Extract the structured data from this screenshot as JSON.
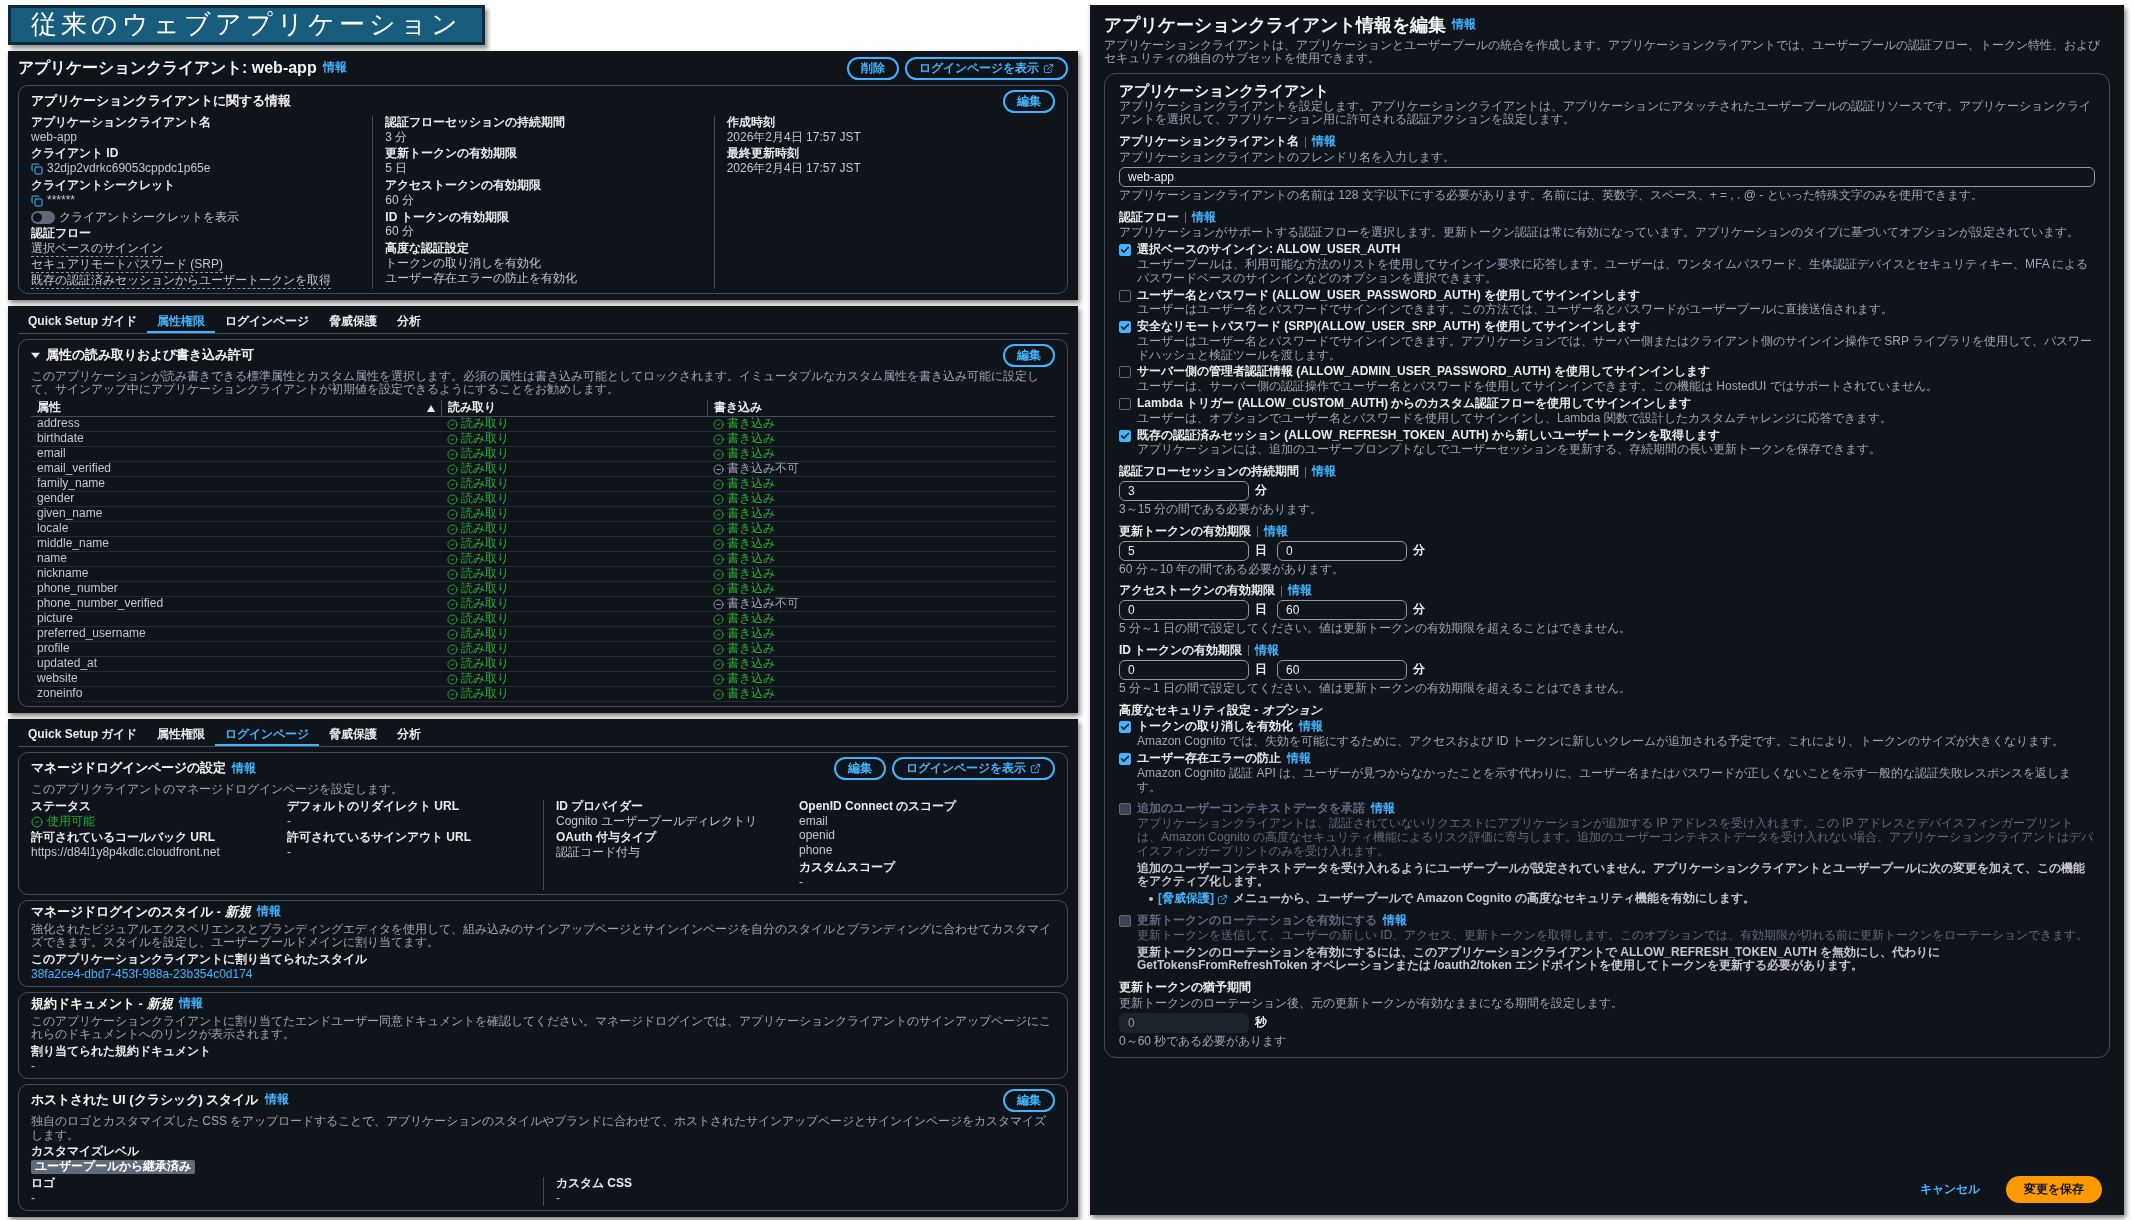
{
  "slide_title": "従来のウェブアプリケーション",
  "client_summary": {
    "title": "アプリケーションクライアント: web-app",
    "info": "情報",
    "buttons": [
      {
        "label": "削除",
        "external": false
      },
      {
        "label": "ログインページを表示",
        "external": true
      }
    ],
    "card": {
      "title": "アプリケーションクライアントに関する情報",
      "buttons": [
        {
          "label": "編集",
          "external": false
        }
      ],
      "rows": [
        [
          [
            {
              "label": "アプリケーションクライアント名",
              "kind": "text",
              "values": [
                "web-app"
              ]
            },
            {
              "label": "クライアント ID",
              "kind": "copy",
              "values": [
                "32djp2vdrkc69053cppdc1p65e"
              ]
            },
            {
              "label": "クライアントシークレット",
              "kind": "copy",
              "values": [
                "******"
              ]
            },
            {
              "label": "クライアントシークレットを表示",
              "kind": "toggle",
              "on": false
            },
            {
              "label": "認証フロー",
              "kind": "links",
              "values": [
                "選択ベースのサインイン",
                "セキュアリモートパスワード (SRP)",
                "既存の認証済みセッションからユーザートークンを取得"
              ]
            }
          ],
          [
            {
              "label": "認証フローセッションの持続期間",
              "kind": "text",
              "values": [
                "3 分"
              ]
            },
            {
              "label": "更新トークンの有効期限",
              "kind": "text",
              "values": [
                "5 日"
              ]
            },
            {
              "label": "アクセストークンの有効期限",
              "kind": "text",
              "values": [
                "60 分"
              ]
            },
            {
              "label": "ID トークンの有効期限",
              "kind": "text",
              "values": [
                "60 分"
              ]
            },
            {
              "label": "高度な認証設定",
              "kind": "text",
              "values": [
                "トークンの取り消しを有効化",
                "ユーザー存在エラーの防止を有効化"
              ]
            }
          ],
          [
            {
              "label": "作成時刻",
              "kind": "text",
              "values": [
                "2026年2月4日 17:57 JST"
              ]
            },
            {
              "label": "最終更新時刻",
              "kind": "text",
              "values": [
                "2026年2月4日 17:57 JST"
              ]
            }
          ]
        ]
      ]
    }
  },
  "attributes_tab": {
    "tabs": [
      {
        "label": "Quick Setup ガイド",
        "selected": false
      },
      {
        "label": "属性権限",
        "selected": true
      },
      {
        "label": "ログインページ",
        "selected": false
      },
      {
        "label": "脅威保護",
        "selected": false
      },
      {
        "label": "分析",
        "selected": false
      }
    ],
    "section": {
      "title": "属性の読み取りおよび書き込み許可",
      "expanded": true,
      "buttons": [
        {
          "label": "編集",
          "external": false
        }
      ],
      "desc": "このアプリケーションが読み書きできる標準属性とカスタム属性を選択します。必須の属性は書き込み可能としてロックされます。イミュータブルなカスタム属性を書き込み可能に設定して、サインアップ中にアプリケーションクライアントが初期値を設定できるようにすることをお勧めします。",
      "columns": [
        {
          "label": "属性",
          "sorted": true
        },
        {
          "label": "読み取り",
          "sorted": false
        },
        {
          "label": "書き込み",
          "sorted": false
        }
      ],
      "rows": [
        {
          "attribute": "address",
          "read": "読み取り",
          "read_allowed": true,
          "write": "書き込み",
          "write_allowed": true
        },
        {
          "attribute": "birthdate",
          "read": "読み取り",
          "read_allowed": true,
          "write": "書き込み",
          "write_allowed": true
        },
        {
          "attribute": "email",
          "read": "読み取り",
          "read_allowed": true,
          "write": "書き込み",
          "write_allowed": true
        },
        {
          "attribute": "email_verified",
          "read": "読み取り",
          "read_allowed": true,
          "write": "書き込み不可",
          "write_allowed": false
        },
        {
          "attribute": "family_name",
          "read": "読み取り",
          "read_allowed": true,
          "write": "書き込み",
          "write_allowed": true
        },
        {
          "attribute": "gender",
          "read": "読み取り",
          "read_allowed": true,
          "write": "書き込み",
          "write_allowed": true
        },
        {
          "attribute": "given_name",
          "read": "読み取り",
          "read_allowed": true,
          "write": "書き込み",
          "write_allowed": true
        },
        {
          "attribute": "locale",
          "read": "読み取り",
          "read_allowed": true,
          "write": "書き込み",
          "write_allowed": true
        },
        {
          "attribute": "middle_name",
          "read": "読み取り",
          "read_allowed": true,
          "write": "書き込み",
          "write_allowed": true
        },
        {
          "attribute": "name",
          "read": "読み取り",
          "read_allowed": true,
          "write": "書き込み",
          "write_allowed": true
        },
        {
          "attribute": "nickname",
          "read": "読み取り",
          "read_allowed": true,
          "write": "書き込み",
          "write_allowed": true
        },
        {
          "attribute": "phone_number",
          "read": "読み取り",
          "read_allowed": true,
          "write": "書き込み",
          "write_allowed": true
        },
        {
          "attribute": "phone_number_verified",
          "read": "読み取り",
          "read_allowed": true,
          "write": "書き込み不可",
          "write_allowed": false
        },
        {
          "attribute": "picture",
          "read": "読み取り",
          "read_allowed": true,
          "write": "書き込み",
          "write_allowed": true
        },
        {
          "attribute": "preferred_username",
          "read": "読み取り",
          "read_allowed": true,
          "write": "書き込み",
          "write_allowed": true
        },
        {
          "attribute": "profile",
          "read": "読み取り",
          "read_allowed": true,
          "write": "書き込み",
          "write_allowed": true
        },
        {
          "attribute": "updated_at",
          "read": "読み取り",
          "read_allowed": true,
          "write": "書き込み",
          "write_allowed": true
        },
        {
          "attribute": "website",
          "read": "読み取り",
          "read_allowed": true,
          "write": "書き込み",
          "write_allowed": true
        },
        {
          "attribute": "zoneinfo",
          "read": "読み取り",
          "read_allowed": true,
          "write": "書き込み",
          "write_allowed": true
        }
      ]
    }
  },
  "login_tab": {
    "tabs": [
      {
        "label": "Quick Setup ガイド",
        "selected": false
      },
      {
        "label": "属性権限",
        "selected": false
      },
      {
        "label": "ログインページ",
        "selected": true
      },
      {
        "label": "脅威保護",
        "selected": false
      },
      {
        "label": "分析",
        "selected": false
      }
    ],
    "sections": [
      {
        "title": "マネージドログインページの設定",
        "info": "情報",
        "buttons": [
          {
            "label": "編集",
            "external": false
          },
          {
            "label": "ログインページを表示",
            "external": true
          }
        ],
        "desc": "このアプリクライアントのマネージドログインページを設定します。",
        "rows": [
          [
            [
              {
                "label": "ステータス",
                "kind": "status",
                "values": [
                  "使用可能"
                ]
              },
              {
                "label": "許可されているコールバック URL",
                "kind": "text",
                "values": [
                  "https://d84l1y8p4kdlc.cloudfront.net"
                ]
              }
            ],
            [
              {
                "label": "デフォルトのリダイレクト URL",
                "kind": "text",
                "values": [
                  "-"
                ]
              },
              {
                "label": "許可されているサインアウト URL",
                "kind": "text",
                "values": [
                  "-"
                ]
              }
            ],
            [
              {
                "label": "ID プロバイダー",
                "kind": "text",
                "values": [
                  "Cognito ユーザープールディレクトリ"
                ]
              },
              {
                "label": "OAuth 付与タイプ",
                "kind": "text",
                "values": [
                  "認証コード付与"
                ]
              }
            ],
            [
              {
                "label": "OpenID Connect のスコープ",
                "kind": "text",
                "values": [
                  "email",
                  "openid",
                  "phone"
                ]
              },
              {
                "label": "カスタムスコープ",
                "kind": "text",
                "values": [
                  "-"
                ]
              }
            ]
          ]
        ]
      },
      {
        "title": "マネージドログインのスタイル - *新規*",
        "info": "情報",
        "desc": "強化されたビジュアルエクスペリエンスとブランディングエディタを使用して、組み込みのサインアップページとサインインページを自分のスタイルとブランディングに合わせてカスタマイズできます。スタイルを設定し、ユーザープールドメインに割り当てます。",
        "rows": [
          [
            [
              {
                "label": "このアプリケーションクライアントに割り当てられたスタイル",
                "kind": "link",
                "values": [
                  "38fa2ce4-dbd7-453f-988a-23b354c0d174"
                ]
              }
            ]
          ]
        ]
      },
      {
        "title": "規約ドキュメント - *新規*",
        "info": "情報",
        "desc": "このアプリケーションクライアントに割り当てたエンドユーザー同意ドキュメントを確認してください。マネージドログインでは、アプリケーションクライアントのサインアップページにこれらのドキュメントへのリンクが表示されます。",
        "rows": [
          [
            [
              {
                "label": "割り当てられた規約ドキュメント",
                "kind": "text",
                "values": [
                  "-"
                ]
              }
            ]
          ]
        ]
      },
      {
        "title": "ホストされた UI (クラシック) スタイル",
        "info": "情報",
        "buttons": [
          {
            "label": "編集",
            "external": false
          }
        ],
        "desc": "独自のロゴとカスタマイズした CSS をアップロードすることで、アプリケーションのスタイルやブランドに合わせて、ホストされたサインアップページとサインインページをカスタマイズします。",
        "rows": [
          [
            [
              {
                "label": "カスタマイズレベル",
                "kind": "badge",
                "values": [
                  "ユーザープールから継承済み"
                ]
              }
            ]
          ],
          [
            [
              {
                "label": "ロゴ",
                "kind": "text",
                "values": [
                  "-"
                ]
              }
            ],
            [
              {
                "label": "カスタム CSS",
                "kind": "text",
                "values": [
                  "-"
                ]
              }
            ]
          ]
        ]
      }
    ]
  },
  "edit_form": {
    "title": "アプリケーションクライアント情報を編集",
    "info": "情報",
    "desc": "アプリケーションクライアントは、アプリケーションとユーザープールの統合を作成します。アプリケーションクライアントでは、ユーザープールの認証フロー、トークン特性、およびセキュリティの独自のサブセットを使用できます。",
    "container": {
      "title": "アプリケーションクライアント",
      "desc": "アプリケーションクライアントを設定します。アプリケーションクライアントは、アプリケーションにアタッチされたユーザープールの認証リソースです。アプリケーションクライアントを選択して、アプリケーション用に許可される認証アクションを設定します。",
      "blocks": [
        {
          "kind": "text_input",
          "label": "アプリケーションクライアント名",
          "info": "情報",
          "desc": "アプリケーションクライアントのフレンドリ名を入力します。",
          "value": "web-app",
          "hint": "アプリケーションクライアントの名前は 128 文字以下にする必要があります。名前には、英数字、スペース、+ = , . @ - といった特殊文字のみを使用できます。"
        },
        {
          "kind": "checks",
          "label": "認証フロー",
          "info": "情報",
          "desc": "アプリケーションがサポートする認証フローを選択します。更新トークン認証は常に有効になっています。アプリケーションのタイプに基づいてオプションが設定されています。",
          "options": [
            {
              "label": "選択ベースのサインイン: ALLOW_USER_AUTH",
              "checked": true,
              "desc": "ユーザープールは、利用可能な方法のリストを使用してサインイン要求に応答します。ユーザーは、ワンタイムパスワード、生体認証デバイスとセキュリティキー、MFA によるパスワードベースのサインインなどのオプションを選択できます。"
            },
            {
              "label": "ユーザー名とパスワード (ALLOW_USER_PASSWORD_AUTH) を使用してサインインします",
              "checked": false,
              "desc": "ユーザーはユーザー名とパスワードでサインインできます。この方法では、ユーザー名とパスワードがユーザープールに直接送信されます。"
            },
            {
              "label": "安全なリモートパスワード (SRP)(ALLOW_USER_SRP_AUTH) を使用してサインインします",
              "checked": true,
              "desc": "ユーザーはユーザー名とパスワードでサインインできます。アプリケーションでは、サーバー側またはクライアント側のサインイン操作で SRP ライブラリを使用して、パスワードハッシュと検証ツールを渡します。"
            },
            {
              "label": "サーバー側の管理者認証情報 (ALLOW_ADMIN_USER_PASSWORD_AUTH) を使用してサインインします",
              "checked": false,
              "desc": "ユーザーは、サーバー側の認証操作でユーザー名とパスワードを使用してサインインできます。この機能は HostedUI ではサポートされていません。"
            },
            {
              "label": "Lambda トリガー (ALLOW_CUSTOM_AUTH) からのカスタム認証フローを使用してサインインします",
              "checked": false,
              "desc": "ユーザーは、オプションでユーザー名とパスワードを使用してサインインし、Lambda 関数で設計したカスタムチャレンジに応答できます。"
            },
            {
              "label": "既存の認証済みセッション (ALLOW_REFRESH_TOKEN_AUTH) から新しいユーザートークンを取得します",
              "checked": true,
              "desc": "アプリケーションには、追加のユーザープロンプトなしでユーザーセッションを更新する、存続期間の長い更新トークンを保存できます。"
            }
          ]
        },
        {
          "kind": "duration",
          "label": "認証フローセッションの持続期間",
          "info": "情報",
          "inputs": [
            {
              "value": "3",
              "unit": "分"
            }
          ],
          "hint": "3～15 分の間である必要があります。"
        },
        {
          "kind": "duration",
          "label": "更新トークンの有効期限",
          "info": "情報",
          "inputs": [
            {
              "value": "5",
              "unit": "日"
            },
            {
              "value": "0",
              "unit": "分"
            }
          ],
          "hint": "60 分～10 年の間である必要があります。"
        },
        {
          "kind": "duration",
          "label": "アクセストークンの有効期限",
          "info": "情報",
          "inputs": [
            {
              "value": "0",
              "unit": "日"
            },
            {
              "value": "60",
              "unit": "分"
            }
          ],
          "hint": "5 分～1 日の間で設定してください。値は更新トークンの有効期限を超えることはできません。"
        },
        {
          "kind": "duration",
          "label": "ID トークンの有効期限",
          "info": "情報",
          "inputs": [
            {
              "value": "0",
              "unit": "日"
            },
            {
              "value": "60",
              "unit": "分"
            }
          ],
          "hint": "5 分～1 日の間で設定してください。値は更新トークンの有効期限を超えることはできません。"
        },
        {
          "kind": "checks",
          "label": "高度なセキュリティ設定 - *オプション*",
          "options": [
            {
              "label": "トークンの取り消しを有効化",
              "info": "情報",
              "checked": true,
              "disabled": false,
              "desc": "Amazon Cognito では、失効を可能にするために、アクセスおよび ID トークンに新しいクレームが追加される予定です。これにより、トークンのサイズが大きくなります。"
            },
            {
              "label": "ユーザー存在エラーの防止",
              "info": "情報",
              "checked": true,
              "disabled": false,
              "desc": "Amazon Cognito 認証 API は、ユーザーが見つからなかったことを示す代わりに、ユーザー名またはパスワードが正しくないことを示す一般的な認証失敗レスポンスを返します。"
            },
            {
              "label": "追加のユーザーコンテキストデータを承諾",
              "info": "情報",
              "checked": false,
              "disabled": true,
              "desc": "アプリケーションクライアントは、認証されていないリクエストにアプリケーションが追加する IP アドレスを受け入れます。この IP アドレスとデバイスフィンガープリントは、Amazon Cognito の高度なセキュリティ機能によるリスク評価に寄与します。追加のユーザーコンテキストデータを受け入れない場合、アプリケーションクライアントはデバイスフィンガープリントのみを受け入れます。",
              "note": "追加のユーザーコンテキストデータを受け入れるようにユーザープールが設定されていません。アプリケーションクライアントとユーザープールに次の変更を加えて、この機能をアクティブ化します。",
              "bullet": {
                "link": "[脅威保護]",
                "text": "メニューから、ユーザープールで Amazon Cognito の高度なセキュリティ機能を有効にします。"
              }
            },
            {
              "label": "更新トークンのローテーションを有効にする",
              "info": "情報",
              "checked": false,
              "disabled": true,
              "desc": "更新トークンを送信して、ユーザーの新しい ID、アクセス、更新トークンを取得します。このオプションでは、有効期限が切れる前に更新トークンをローテーションできます。",
              "note": "更新トークンのローテーションを有効にするには、このアプリケーションクライアントで ALLOW_REFRESH_TOKEN_AUTH を無効にし、代わりに GetTokensFromRefreshToken オペレーションまたは /oauth2/token エンドポイントを使用してトークンを更新する必要があります。"
            }
          ]
        },
        {
          "kind": "duration",
          "label": "更新トークンの猶予期間",
          "desc": "更新トークンのローテーション後、元の更新トークンが有効なままになる期間を設定します。",
          "inputs": [
            {
              "value": "0",
              "unit": "秒",
              "disabled": true
            }
          ],
          "hint": "0～60 秒である必要があります"
        }
      ]
    },
    "cancel": "キャンセル",
    "save": "変更を保存"
  }
}
